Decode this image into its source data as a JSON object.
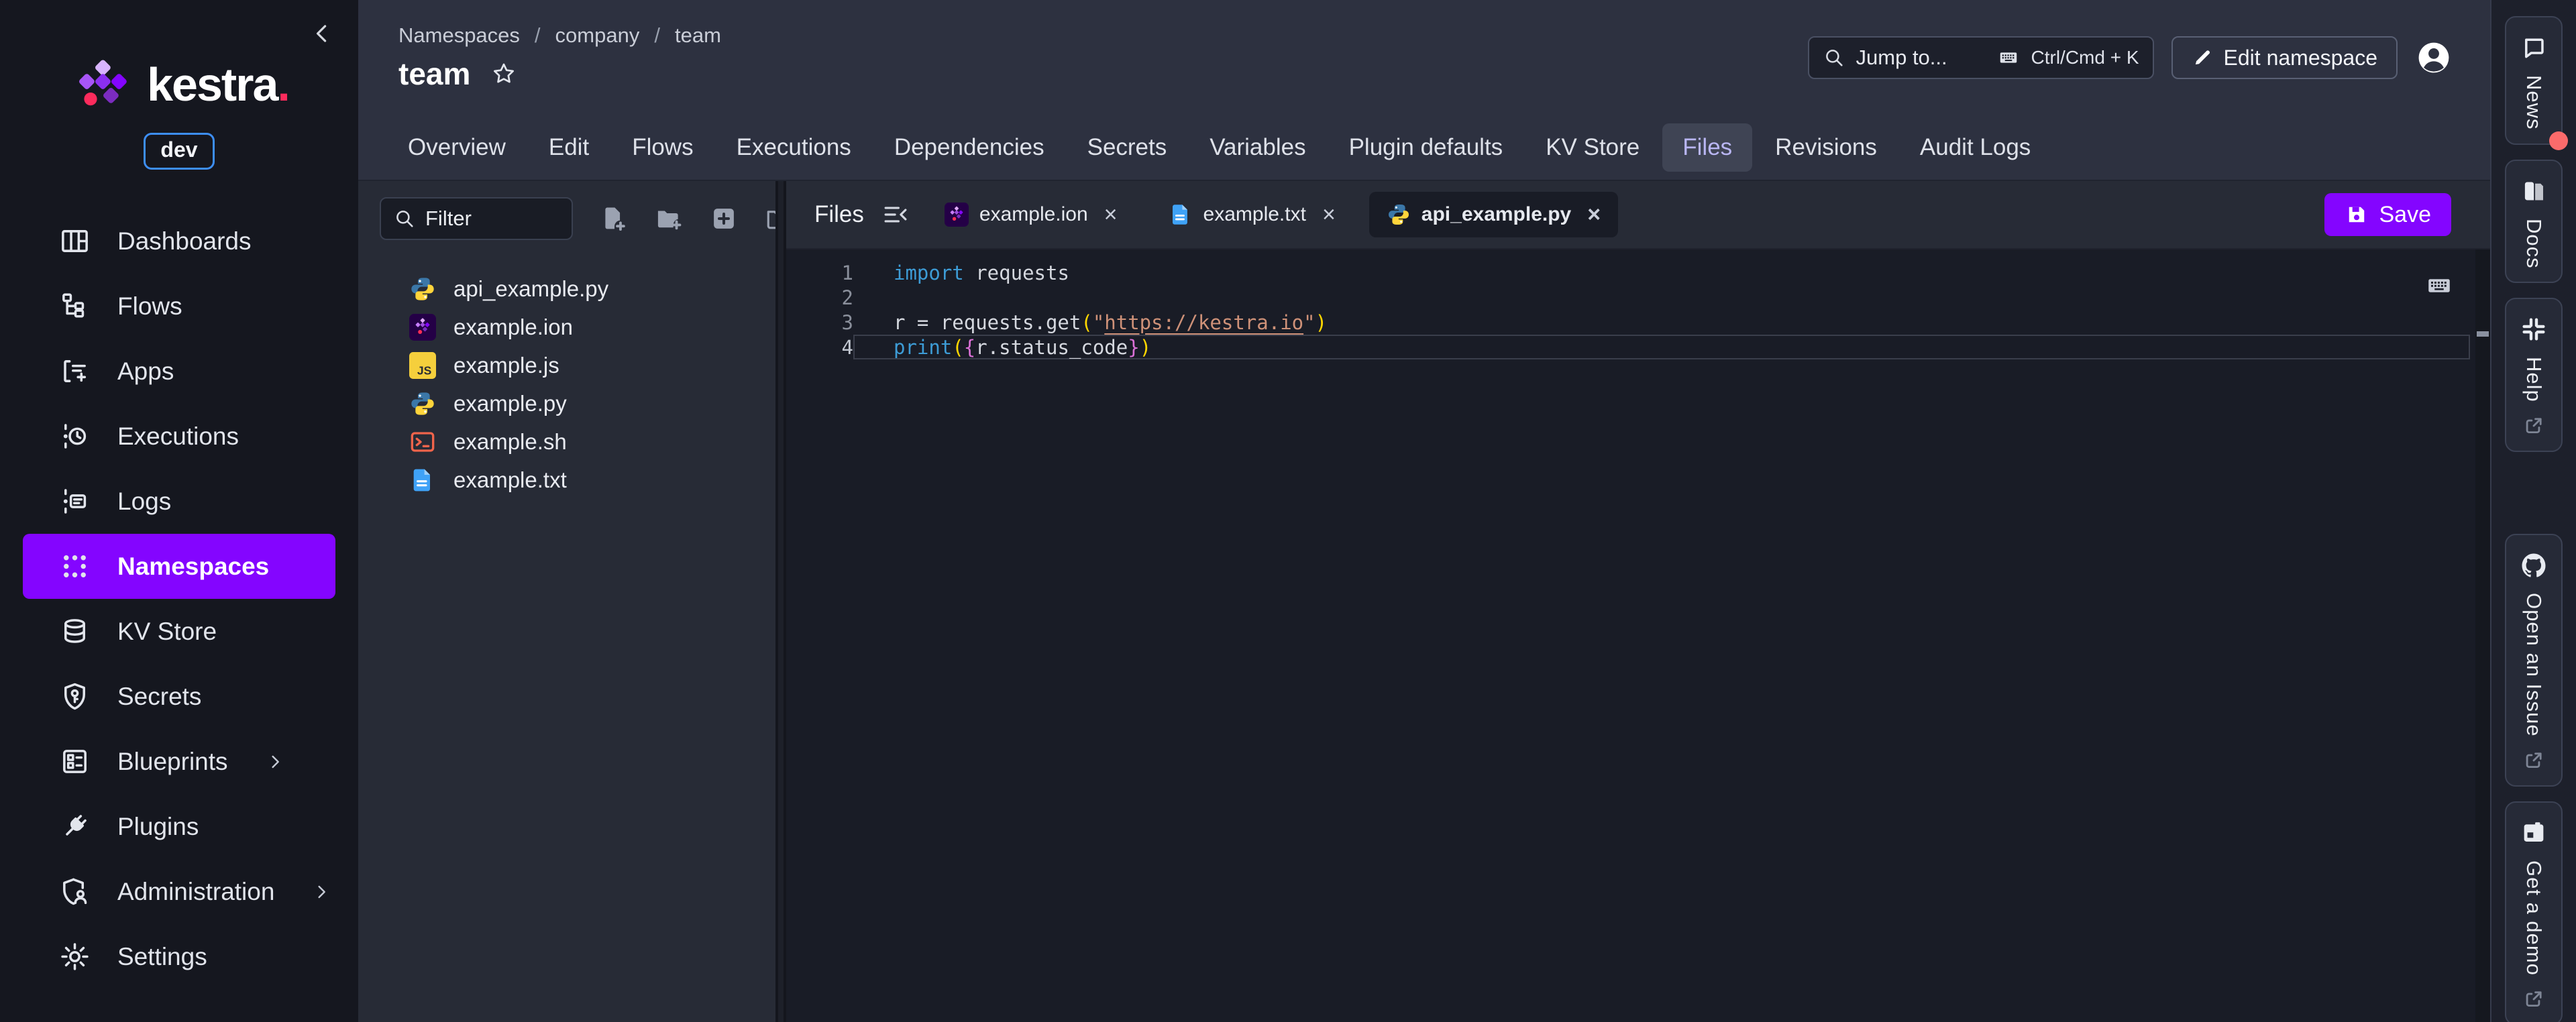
{
  "app": {
    "brand": "kestra",
    "brand_dot": ".",
    "env_badge": "dev"
  },
  "sidebar": {
    "items": [
      {
        "label": "Dashboards",
        "icon": "dashboards"
      },
      {
        "label": "Flows",
        "icon": "flows"
      },
      {
        "label": "Apps",
        "icon": "apps"
      },
      {
        "label": "Executions",
        "icon": "executions"
      },
      {
        "label": "Logs",
        "icon": "logs"
      },
      {
        "label": "Namespaces",
        "icon": "namespaces",
        "active": true
      },
      {
        "label": "KV Store",
        "icon": "kvstore"
      },
      {
        "label": "Secrets",
        "icon": "secrets"
      },
      {
        "label": "Blueprints",
        "icon": "blueprints",
        "chevron": true
      },
      {
        "label": "Plugins",
        "icon": "plugins"
      },
      {
        "label": "Administration",
        "icon": "administration",
        "chevron": true
      },
      {
        "label": "Settings",
        "icon": "settings"
      }
    ]
  },
  "header": {
    "breadcrumb": [
      "Namespaces",
      "company",
      "team"
    ],
    "title": "team",
    "search_placeholder": "Jump to...",
    "search_shortcut": "Ctrl/Cmd + K",
    "edit_button": "Edit namespace"
  },
  "tabs": {
    "active": "Files",
    "items": [
      "Overview",
      "Edit",
      "Flows",
      "Executions",
      "Dependencies",
      "Secrets",
      "Variables",
      "Plugin defaults",
      "KV Store",
      "Files",
      "Revisions",
      "Audit Logs"
    ]
  },
  "files_panel": {
    "filter_placeholder": "Filter",
    "toolbar_icons": [
      "file-plus",
      "folder-plus",
      "plus-box",
      "folder-import"
    ],
    "files": [
      {
        "name": "api_example.py",
        "type": "python"
      },
      {
        "name": "example.ion",
        "type": "ion"
      },
      {
        "name": "example.js",
        "type": "javascript"
      },
      {
        "name": "example.py",
        "type": "python"
      },
      {
        "name": "example.sh",
        "type": "shell"
      },
      {
        "name": "example.txt",
        "type": "text"
      }
    ]
  },
  "editor": {
    "panel_label": "Files",
    "open_tabs": [
      {
        "name": "example.ion",
        "type": "ion"
      },
      {
        "name": "example.txt",
        "type": "text"
      },
      {
        "name": "api_example.py",
        "type": "python",
        "active": true
      }
    ],
    "save_button": "Save",
    "active_line": 4,
    "lines": [
      {
        "num": "1",
        "tokens": [
          {
            "text": "import",
            "style": "kw"
          },
          {
            "text": " requests",
            "style": "plain"
          }
        ]
      },
      {
        "num": "2",
        "tokens": []
      },
      {
        "num": "3",
        "tokens": [
          {
            "text": "r = requests.get",
            "style": "plain"
          },
          {
            "text": "(",
            "style": "b1"
          },
          {
            "text": "\"",
            "style": "str"
          },
          {
            "text": "https://kestra.io",
            "style": "link"
          },
          {
            "text": "\"",
            "style": "str"
          },
          {
            "text": ")",
            "style": "b1"
          }
        ]
      },
      {
        "num": "4",
        "tokens": [
          {
            "text": "print",
            "style": "kw"
          },
          {
            "text": "(",
            "style": "b1"
          },
          {
            "text": "{",
            "style": "b2"
          },
          {
            "text": "r.status_code",
            "style": "plain"
          },
          {
            "text": "}",
            "style": "b2"
          },
          {
            "text": ")",
            "style": "b1"
          }
        ]
      }
    ]
  },
  "rail": {
    "buttons": [
      {
        "label": "News",
        "icon": "news",
        "notification": true
      },
      {
        "label": "Docs",
        "icon": "docs"
      },
      {
        "label": "Help",
        "icon": "slack",
        "external": true
      },
      {
        "label": "Open an Issue",
        "icon": "github",
        "external": true,
        "group_start": true
      },
      {
        "label": "Get a demo",
        "icon": "demo",
        "external": true
      }
    ]
  },
  "colors": {
    "accent": "#8405FF",
    "pink_dot": "#FC2B5C",
    "env_badge_border": "#3D8EF5",
    "notification": "#FB6B6B",
    "keyword": "#3D9CD6",
    "string": "#CE9178",
    "bracket_level1": "#FFD700",
    "bracket_level2": "#DA70D6"
  }
}
